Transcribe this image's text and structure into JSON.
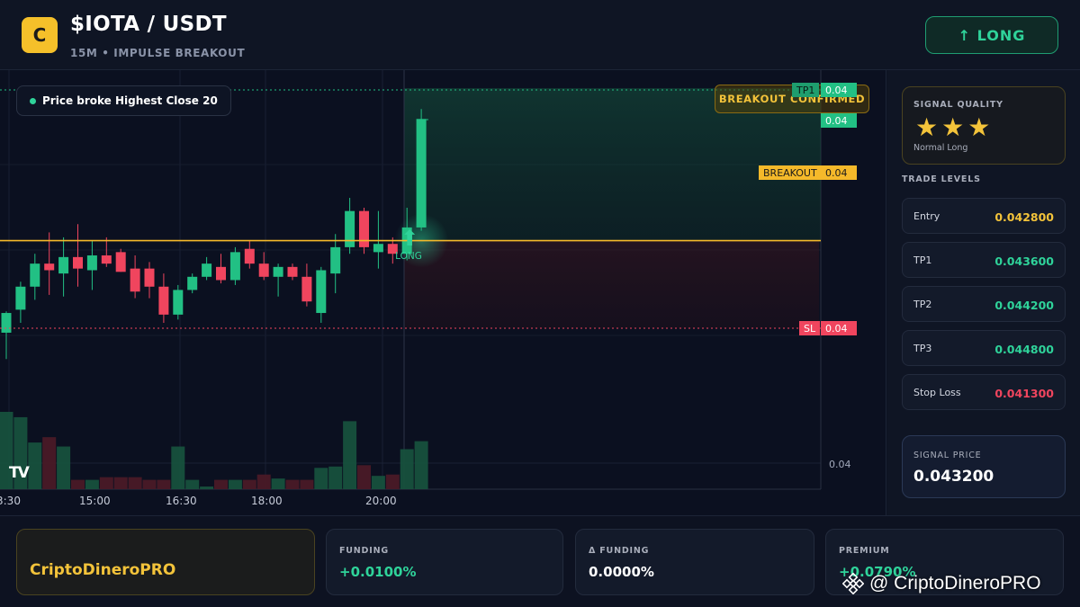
{
  "header": {
    "logo_letter": "C",
    "pair": "$IOTA / USDT",
    "subtitle": "15M • IMPULSE BREAKOUT",
    "long_button": "↑ LONG"
  },
  "chart": {
    "info_tag": "Price broke Highest Close 20",
    "badge": "BREAKOUT CONFIRMED",
    "labels": {
      "tp1": "TP1",
      "tp1_value": "0.04",
      "top_value": "0.04",
      "breakout": "BREAKOUT",
      "breakout_value": "0.04",
      "sl": "SL",
      "sl_value": "0.04",
      "axis_value": "0.04"
    },
    "signal_marker": "LONG",
    "time_labels": [
      "3:30",
      "15:00",
      "16:30",
      "18:00",
      "20:00"
    ],
    "watermark_logo": "TV",
    "colors": {
      "up": "#22c084",
      "down": "#f0455e",
      "breakout": "#f5b92a"
    }
  },
  "chart_data": {
    "type": "candlestick",
    "x": [
      "3:30",
      "15:00",
      "16:30",
      "18:00",
      "20:00"
    ],
    "candles": [
      {
        "o": 0.04264,
        "h": 0.04277,
        "l": 0.04248,
        "c": 0.04276
      },
      {
        "o": 0.04278,
        "h": 0.04295,
        "l": 0.0427,
        "c": 0.04292
      },
      {
        "o": 0.04292,
        "h": 0.04312,
        "l": 0.04284,
        "c": 0.04306
      },
      {
        "o": 0.04306,
        "h": 0.04325,
        "l": 0.04287,
        "c": 0.04302
      },
      {
        "o": 0.043,
        "h": 0.04322,
        "l": 0.04286,
        "c": 0.0431
      },
      {
        "o": 0.0431,
        "h": 0.0433,
        "l": 0.04292,
        "c": 0.04303
      },
      {
        "o": 0.04302,
        "h": 0.0432,
        "l": 0.0429,
        "c": 0.04311
      },
      {
        "o": 0.04311,
        "h": 0.04322,
        "l": 0.04304,
        "c": 0.04306
      },
      {
        "o": 0.04313,
        "h": 0.04315,
        "l": 0.04301,
        "c": 0.04301
      },
      {
        "o": 0.04303,
        "h": 0.04311,
        "l": 0.04285,
        "c": 0.04289
      },
      {
        "o": 0.04303,
        "h": 0.04307,
        "l": 0.04285,
        "c": 0.04292
      },
      {
        "o": 0.04292,
        "h": 0.043,
        "l": 0.0427,
        "c": 0.04275
      },
      {
        "o": 0.04275,
        "h": 0.04293,
        "l": 0.04272,
        "c": 0.0429
      },
      {
        "o": 0.0429,
        "h": 0.043,
        "l": 0.04288,
        "c": 0.04298
      },
      {
        "o": 0.04298,
        "h": 0.0431,
        "l": 0.04296,
        "c": 0.04306
      },
      {
        "o": 0.04304,
        "h": 0.04312,
        "l": 0.04294,
        "c": 0.04296
      },
      {
        "o": 0.04296,
        "h": 0.04316,
        "l": 0.04293,
        "c": 0.04313
      },
      {
        "o": 0.04315,
        "h": 0.0432,
        "l": 0.04303,
        "c": 0.04306
      },
      {
        "o": 0.04306,
        "h": 0.04313,
        "l": 0.04296,
        "c": 0.04298
      },
      {
        "o": 0.04298,
        "h": 0.04306,
        "l": 0.04286,
        "c": 0.04304
      },
      {
        "o": 0.04304,
        "h": 0.04306,
        "l": 0.04296,
        "c": 0.04298
      },
      {
        "o": 0.04298,
        "h": 0.04306,
        "l": 0.0428,
        "c": 0.04283
      },
      {
        "o": 0.04276,
        "h": 0.04304,
        "l": 0.0427,
        "c": 0.04302
      },
      {
        "o": 0.043,
        "h": 0.04324,
        "l": 0.04288,
        "c": 0.04316
      },
      {
        "o": 0.04316,
        "h": 0.04346,
        "l": 0.04312,
        "c": 0.04338
      },
      {
        "o": 0.04338,
        "h": 0.0434,
        "l": 0.04312,
        "c": 0.04316
      },
      {
        "o": 0.04313,
        "h": 0.04338,
        "l": 0.04303,
        "c": 0.04318
      },
      {
        "o": 0.04318,
        "h": 0.04322,
        "l": 0.04306,
        "c": 0.04312
      },
      {
        "o": 0.04312,
        "h": 0.0434,
        "l": 0.04308,
        "c": 0.04328
      },
      {
        "o": 0.04328,
        "h": 0.044,
        "l": 0.04326,
        "c": 0.04394
      }
    ],
    "volume": [
      5.8,
      5.4,
      3.5,
      3.9,
      3.2,
      0.7,
      0.7,
      0.9,
      0.9,
      0.9,
      0.7,
      0.7,
      3.2,
      0.7,
      0.2,
      0.7,
      0.7,
      0.7,
      1.1,
      0.8,
      0.7,
      0.7,
      1.6,
      1.7,
      5.1,
      1.8,
      1.0,
      1.1,
      3.0,
      3.6
    ],
    "levels": {
      "tp1": 0.0436,
      "breakout": 0.0432,
      "entry": 0.0428,
      "stop_loss": 0.0413
    },
    "grid": true
  },
  "side": {
    "quality_title": "SIGNAL QUALITY",
    "stars": "★★★",
    "quality_note": "Normal Long",
    "levels_title": "TRADE LEVELS",
    "levels": [
      {
        "name": "Entry",
        "value": "0.042800"
      },
      {
        "name": "TP1",
        "value": "0.043600"
      },
      {
        "name": "TP2",
        "value": "0.044200"
      },
      {
        "name": "TP3",
        "value": "0.044800"
      },
      {
        "name": "Stop Loss",
        "value": "0.041300"
      }
    ],
    "signal_price_title": "SIGNAL PRICE",
    "signal_price": "0.043200"
  },
  "footer": {
    "brand": "CriptoDineroPRO",
    "funding_title": "FUNDING",
    "funding_value": "+0.0100%",
    "delta_title": "Δ FUNDING",
    "delta_value": "0.0000%",
    "premium_title": "PREMIUM",
    "premium_value": "+0.0790%",
    "watermark": "@ CriptoDineroPRO"
  }
}
